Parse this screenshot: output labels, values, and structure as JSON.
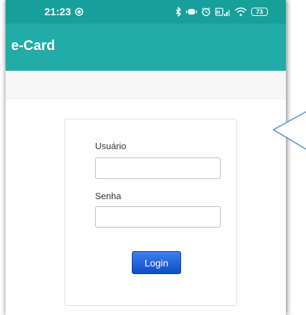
{
  "status_bar": {
    "time": "21:23",
    "battery_level": "73",
    "icons": [
      "record-icon",
      "bluetooth-icon",
      "vibrate-icon",
      "alarm-icon",
      "hd-signal-icon",
      "wifi-icon",
      "battery-icon"
    ]
  },
  "app_bar": {
    "title": "e-Card"
  },
  "login_form": {
    "username_label": "Usuário",
    "username_value": "",
    "password_label": "Senha",
    "password_value": "",
    "login_label": "Login"
  },
  "colors": {
    "status_bar": "#17a09a",
    "app_bar": "#22aca7",
    "login_button": "#1a5fd6",
    "callout_border": "#5b86c9"
  }
}
